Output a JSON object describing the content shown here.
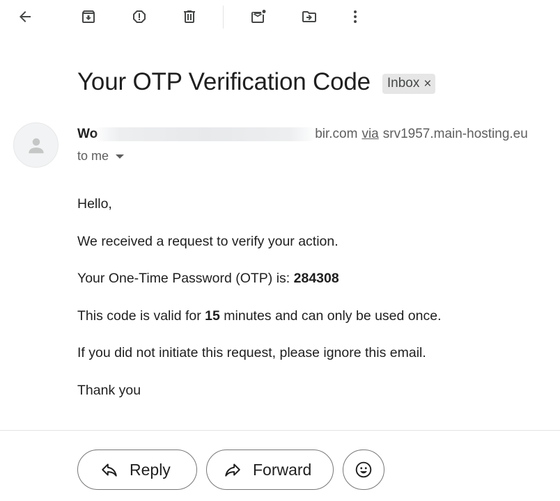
{
  "toolbar": {
    "items": [
      {
        "name": "back-icon",
        "tooltip": "Back"
      },
      {
        "name": "archive-icon",
        "tooltip": "Archive"
      },
      {
        "name": "report-spam-icon",
        "tooltip": "Report spam"
      },
      {
        "name": "delete-icon",
        "tooltip": "Delete"
      },
      {
        "name": "mark-unread-icon",
        "tooltip": "Mark as unread"
      },
      {
        "name": "move-to-icon",
        "tooltip": "Move to"
      },
      {
        "name": "more-icon",
        "tooltip": "More"
      }
    ]
  },
  "message": {
    "subject": "Your OTP Verification Code",
    "label": "Inbox",
    "label_close": "×",
    "sender_name": "Wo",
    "sender_domain_tail": "bir.com",
    "via_text": "via",
    "relay_host": "srv1957.main-hosting.eu",
    "recipient_text": "to me"
  },
  "body": {
    "greeting": "Hello,",
    "line1": "We received a request to verify your action.",
    "line2_prefix": "Your One-Time Password (OTP) is: ",
    "otp_code": "284308",
    "line3_prefix": "This code is valid for ",
    "validity_minutes": "15",
    "line3_suffix": " minutes and can only be used once.",
    "line4": "If you did not initiate this request, please ignore this email.",
    "signoff": "Thank you"
  },
  "actions": {
    "reply_label": "Reply",
    "forward_label": "Forward",
    "emoji_icon": "smiley-icon"
  },
  "colors": {
    "text_primary": "#1f1f1f",
    "text_secondary": "#5e5e5e",
    "chip_bg": "#e6e6e6",
    "button_border": "#747775"
  }
}
